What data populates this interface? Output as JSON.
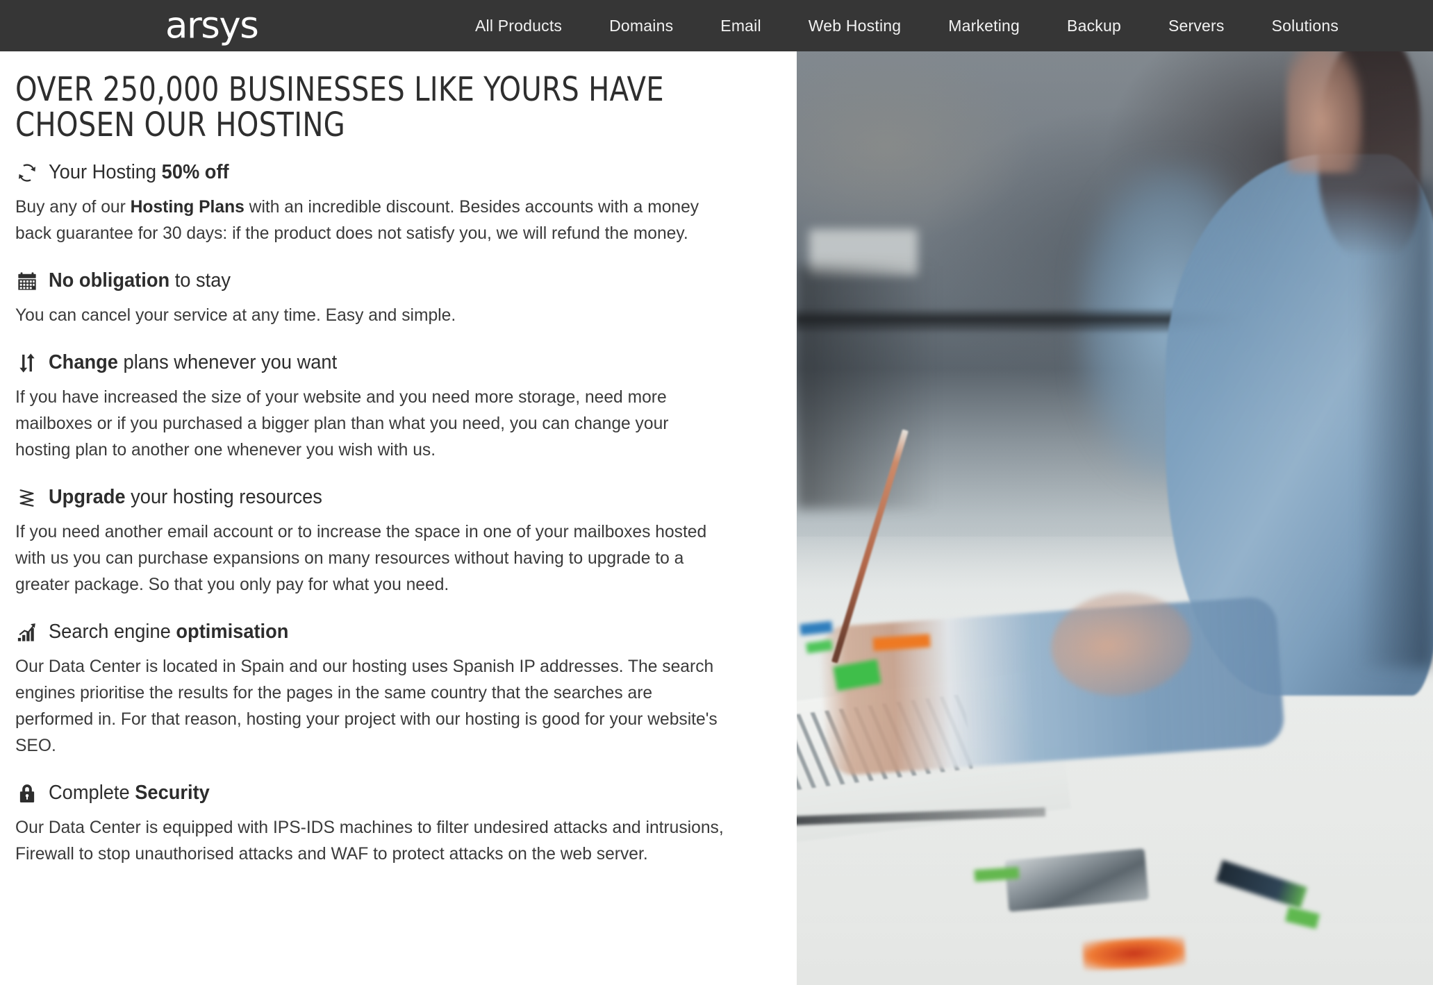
{
  "header": {
    "logo_text": "arsys",
    "brand_color": "#363636",
    "nav_items": [
      {
        "label": "All Products"
      },
      {
        "label": "Domains"
      },
      {
        "label": "Email"
      },
      {
        "label": "Web Hosting"
      },
      {
        "label": "Marketing"
      },
      {
        "label": "Backup"
      },
      {
        "label": "Servers"
      },
      {
        "label": "Solutions"
      }
    ]
  },
  "main": {
    "page_title": "OVER 250,000 BUSINESSES LIKE YOURS HAVE CHOSEN OUR HOSTING",
    "features": [
      {
        "icon": "refresh-cycle-icon",
        "title_plain": "Your Hosting ",
        "title_bold": "50% off",
        "body_pre": "Buy any of our ",
        "body_bold": "Hosting Plans",
        "body_post": " with an incredible discount. Besides accounts with a money back guarantee for 30 days: if the product does not satisfy you, we will refund the money."
      },
      {
        "icon": "calendar-icon",
        "title_bold": "No obligation",
        "title_plain": " to stay",
        "body_pre": "You can cancel your service at any time. Easy and simple.",
        "body_bold": "",
        "body_post": ""
      },
      {
        "icon": "up-down-arrows-icon",
        "title_bold": "Change",
        "title_plain": " plans whenever you want",
        "body_pre": "If you have increased the size of your website and you need more storage, need more mailboxes or if you purchased a bigger plan than what you need, you can change your hosting plan to another one whenever you wish with us.",
        "body_bold": "",
        "body_post": ""
      },
      {
        "icon": "zigzag-stack-icon",
        "title_bold": "Upgrade",
        "title_plain": " your hosting resources",
        "body_pre": "If you need another email account or to increase the space in one of your mailboxes hosted with us you can purchase expansions on many resources without having to upgrade to a greater package. So that you only pay for what you need.",
        "body_bold": "",
        "body_post": ""
      },
      {
        "icon": "bar-chart-growth-icon",
        "title_plain": "Search engine ",
        "title_bold": "optimisation",
        "body_pre": "Our Data Center is located in Spain and our hosting uses Spanish IP addresses. The search engines prioritise the results for the pages in the same country that the searches are performed in. For that reason, hosting your project with our hosting is good for your website's SEO.",
        "body_bold": "",
        "body_post": ""
      },
      {
        "icon": "lock-icon",
        "title_plain": "Complete ",
        "title_bold": "Security",
        "body_pre": "Our Data Center is equipped with IPS-IDS machines to filter undesired attacks and intrusions, Firewall to stop unauthorised attacks and WAF to protect attacks on the web server.",
        "body_bold": "",
        "body_post": ""
      }
    ]
  },
  "photo": {
    "alt": "Blurred photo of a woman in a denim shirt writing with a pencil on documents at a white desk, with a smartphone and coloured markers"
  }
}
